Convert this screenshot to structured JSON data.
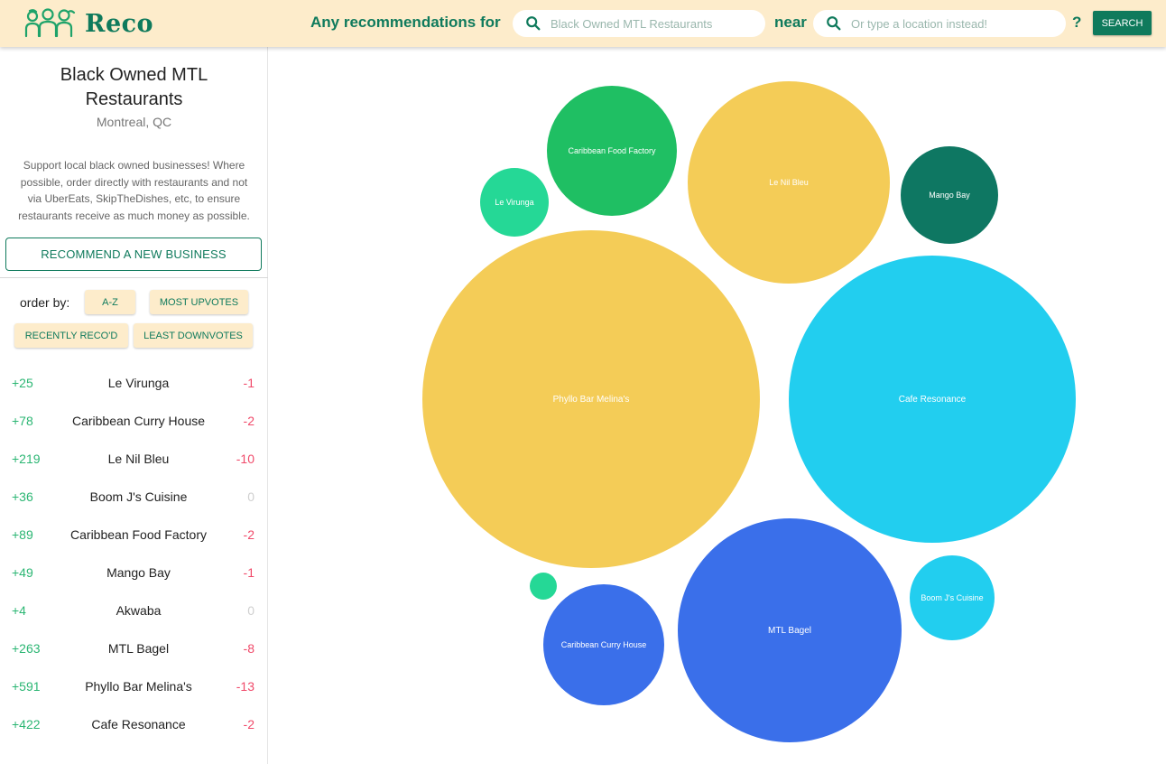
{
  "header": {
    "logo_text": "Reco",
    "prompt_any": "Any recommendations for",
    "prompt_near": "near",
    "topic_placeholder": "Black Owned MTL Restaurants",
    "location_placeholder": "Or type a location instead!",
    "help_label": "?",
    "search_label": "SEARCH"
  },
  "sidebar": {
    "title": "Black Owned MTL Restaurants",
    "location": "Montreal, QC",
    "description": "Support local black owned businesses! Where possible, order directly with restaurants and not via UberEats, SkipTheDishes, etc, to ensure restaurants receive as much money as possible.",
    "recommend_label": "RECOMMEND A NEW BUSINESS",
    "order_by_label": "order by:",
    "sort_options": [
      "A-Z",
      "MOST UPVOTES",
      "RECENTLY RECO'D",
      "LEAST DOWNVOTES"
    ]
  },
  "businesses": [
    {
      "up": "+25",
      "name": "Le Virunga",
      "down": "-1"
    },
    {
      "up": "+78",
      "name": "Caribbean Curry House",
      "down": "-2"
    },
    {
      "up": "+219",
      "name": "Le Nil Bleu",
      "down": "-10"
    },
    {
      "up": "+36",
      "name": "Boom J's Cuisine",
      "down": "0"
    },
    {
      "up": "+89",
      "name": "Caribbean Food Factory",
      "down": "-2"
    },
    {
      "up": "+49",
      "name": "Mango Bay",
      "down": "-1"
    },
    {
      "up": "+4",
      "name": "Akwaba",
      "down": "0"
    },
    {
      "up": "+263",
      "name": "MTL Bagel",
      "down": "-8"
    },
    {
      "up": "+591",
      "name": "Phyllo Bar Melina's",
      "down": "-13"
    },
    {
      "up": "+422",
      "name": "Cafe Resonance",
      "down": "-2"
    }
  ],
  "bubbles": [
    {
      "label": "Phyllo Bar Melina's",
      "color": "#f4cc57"
    },
    {
      "label": "Cafe Resonance",
      "color": "#22ceef"
    },
    {
      "label": "MTL Bagel",
      "color": "#3a6fea"
    },
    {
      "label": "Le Nil Bleu",
      "color": "#f4cc57"
    },
    {
      "label": "Caribbean Food Factory",
      "color": "#1fbf63"
    },
    {
      "label": "Caribbean Curry House",
      "color": "#3a6fea"
    },
    {
      "label": "Mango Bay",
      "color": "#0e7762"
    },
    {
      "label": "Boom J's Cuisine",
      "color": "#22ceef"
    },
    {
      "label": "Le Virunga",
      "color": "#25d896"
    },
    {
      "label": "",
      "color": "#25d896"
    }
  ],
  "colors": {
    "brand": "#0f7a5c",
    "header_bg": "#fdeccb",
    "upvote": "#2bb673",
    "downvote": "#f04a6a"
  }
}
